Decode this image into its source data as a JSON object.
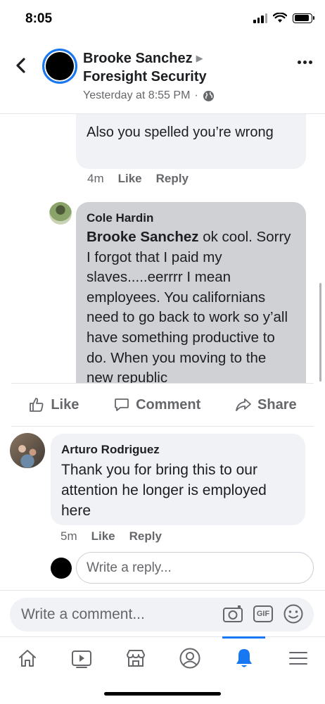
{
  "status_bar": {
    "time": "8:05"
  },
  "header": {
    "name": "Brooke Sanchez",
    "page": "Foresight Security",
    "timestamp": "Yesterday at 8:55 PM",
    "separator": "·"
  },
  "comments": {
    "top_reply": {
      "text": "Also you spelled you’re wrong",
      "time": "4m",
      "like_label": "Like",
      "reply_label": "Reply"
    },
    "cole": {
      "author": "Cole Hardin",
      "mention": "Brooke Sanchez",
      "text": " ok cool. Sorry I forgot that I paid my slaves.....eerrrr I mean employees. You californians need to go back to work so y’all have something productive to do. When you moving to the new republic"
    }
  },
  "actions": {
    "like": "Like",
    "comment": "Comment",
    "share": "Share"
  },
  "arturo": {
    "author": "Arturo Rodriguez",
    "text": "Thank you for bring this to our attention he longer is employed here",
    "time": "5m",
    "like_label": "Like",
    "reply_label": "Reply"
  },
  "reply_box": {
    "placeholder": "Write a reply..."
  },
  "composer": {
    "placeholder": "Write a comment...",
    "gif_label": "GIF"
  },
  "nav": {
    "items": [
      "home-icon",
      "video-icon",
      "marketplace-icon",
      "profile-icon",
      "notifications-icon",
      "menu-icon"
    ],
    "active": "notifications-icon"
  },
  "colors": {
    "accent": "#1877f2",
    "bubble": "#f0f2f5",
    "bubble_highlight": "#d0d1d4",
    "secondary_text": "#65676b"
  }
}
